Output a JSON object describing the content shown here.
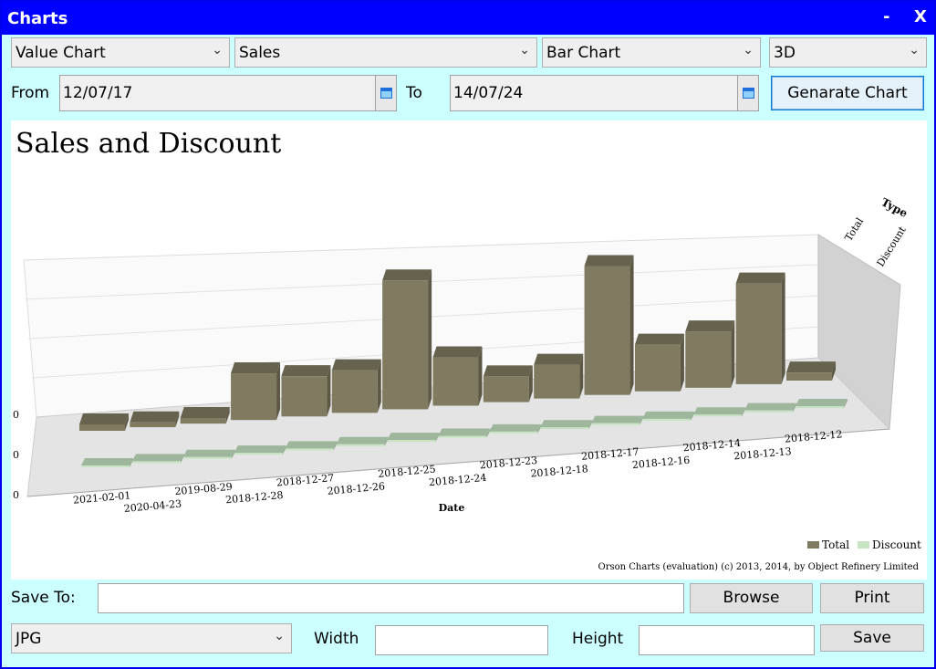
{
  "window": {
    "title": "Charts",
    "minimize_label": "-",
    "close_label": "X"
  },
  "controls": {
    "chart_kind": "Value Chart",
    "metric": "Sales",
    "chart_type": "Bar Chart",
    "dimension": "3D",
    "from_label": "From",
    "from_value": "12/07/17",
    "to_label": "To",
    "to_value": "14/07/24",
    "generate_label": "Genarate Chart"
  },
  "chart_data": {
    "type": "bar",
    "title": "Sales and Discount",
    "xlabel": "Date",
    "zlabel": "Type",
    "categories": [
      "2021-02-01",
      "2020-04-23",
      "2019-08-29",
      "2018-12-28",
      "2018-12-27",
      "2018-12-26",
      "2018-12-25",
      "2018-12-24",
      "2018-12-23",
      "2018-12-18",
      "2018-12-17",
      "2018-12-16",
      "2018-12-14",
      "2018-12-13",
      "2018-12-12"
    ],
    "series": [
      {
        "name": "Total",
        "values": [
          8,
          6,
          7,
          58,
          50,
          53,
          160,
          60,
          32,
          42,
          160,
          58,
          70,
          125,
          10
        ]
      },
      {
        "name": "Discount",
        "values": [
          0,
          0,
          0,
          0,
          0,
          0,
          0,
          0,
          0,
          0,
          2,
          0,
          0,
          2,
          0
        ]
      }
    ],
    "series_colors": [
      "#807a60",
      "#c6e3c2"
    ],
    "z_tick_labels": [
      "Total",
      "Discount"
    ],
    "y_tick_labels": [
      "0",
      "0",
      "0"
    ],
    "legend_position": "bottom-right",
    "footer": "Orson Charts (evaluation) (c) 2013, 2014, by Object Refinery Limited"
  },
  "save": {
    "save_to_label": "Save To:",
    "path_value": "",
    "browse_label": "Browse",
    "print_label": "Print",
    "format": "JPG",
    "width_label": "Width",
    "width_value": "",
    "height_label": "Height",
    "height_value": "",
    "save_label": "Save"
  }
}
